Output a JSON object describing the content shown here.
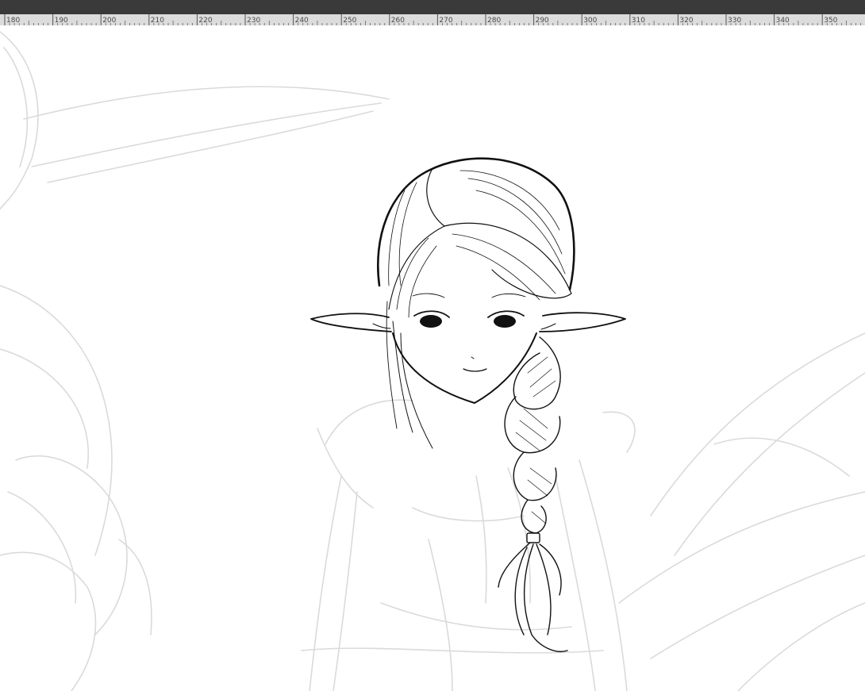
{
  "ruler": {
    "labels": [
      "180",
      "190",
      "200",
      "210",
      "220",
      "230",
      "240",
      "250",
      "260",
      "270",
      "280",
      "290",
      "300",
      "310",
      "320",
      "330",
      "340",
      "350"
    ]
  },
  "canvas": {
    "subject": "elf-girl-inked-drawing",
    "colors": {
      "ink": "#111111",
      "sketch": "#d9d9d9",
      "ruler_bg": "#dcdcdc",
      "topbar_bg": "#3a3a3a"
    }
  }
}
